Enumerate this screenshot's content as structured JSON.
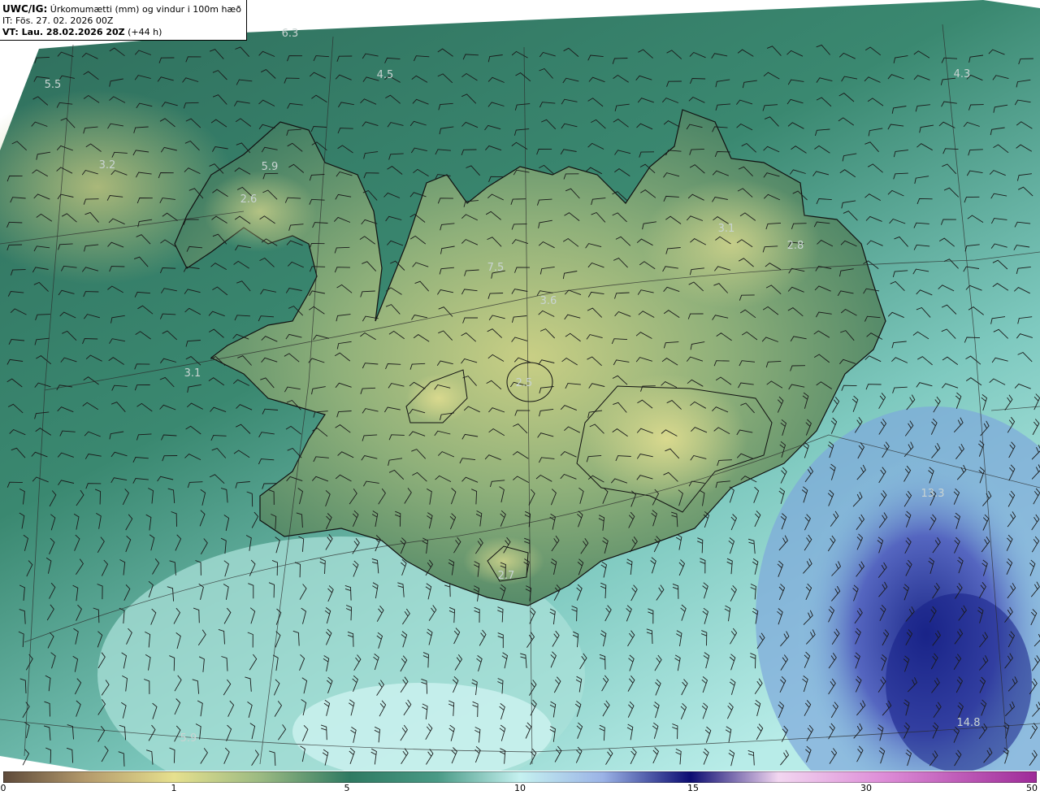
{
  "header": {
    "product": "UWC/IG:",
    "description": "Úrkomumætti (mm) og vindur i 100m hæð",
    "init_time": "IT: Fös. 27. 02. 2026 00Z",
    "valid_prefix": "VT: Lau. 28.02.2026 20Z",
    "valid_suffix": "(+44 h)"
  },
  "colorbar": {
    "ticks": [
      "0",
      "1",
      "5",
      "10",
      "15",
      "30",
      "50"
    ],
    "colors": [
      "#6b4f3a",
      "#b89a6a",
      "#e4e08c",
      "#8fb77f",
      "#3f8a6e",
      "#2e6e5a",
      "#7cc7c0",
      "#bfeff0",
      "#8fa7e0",
      "#2b3a9e",
      "#0a0a6e",
      "#e9a8e6",
      "#b03aa8"
    ]
  },
  "map_values": [
    {
      "text": "6.3"
    },
    {
      "text": "4.5"
    },
    {
      "text": "4.3"
    },
    {
      "text": "5.5"
    },
    {
      "text": "3.2"
    },
    {
      "text": "5.9"
    },
    {
      "text": "2.6"
    },
    {
      "text": "3.1"
    },
    {
      "text": "2.8"
    },
    {
      "text": "7.5"
    },
    {
      "text": "3.6"
    },
    {
      "text": "3.1"
    },
    {
      "text": "2.5"
    },
    {
      "text": "13.3"
    },
    {
      "text": "2.7"
    },
    {
      "text": "14.8"
    },
    {
      "text": "5.9"
    }
  ]
}
